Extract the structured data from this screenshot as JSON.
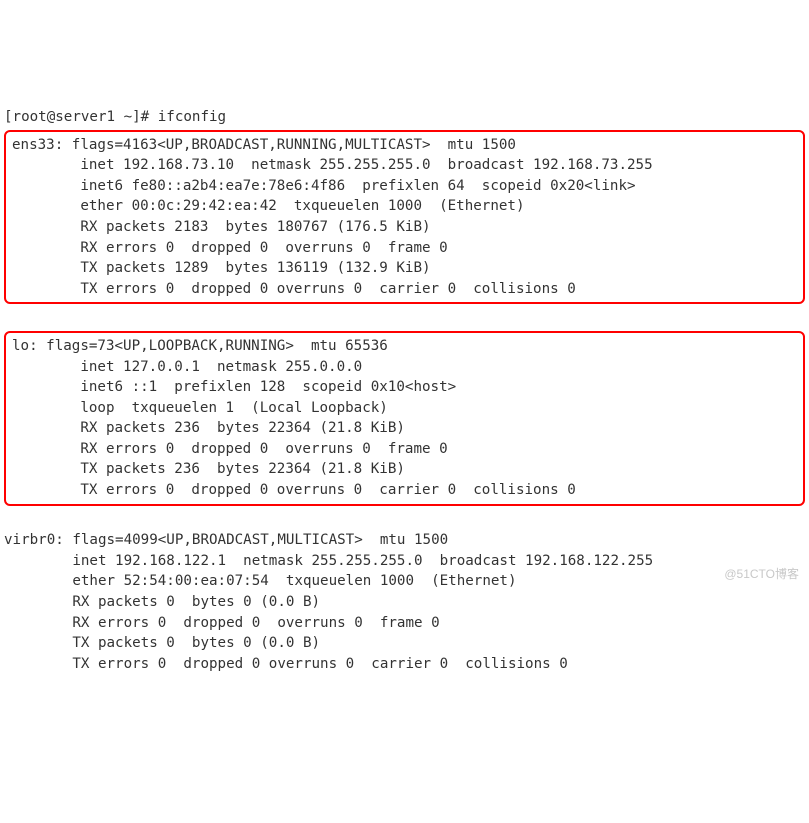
{
  "prompt": "[root@server1 ~]# ifconfig",
  "ens33": {
    "l1": "ens33: flags=4163<UP,BROADCAST,RUNNING,MULTICAST>  mtu 1500",
    "l2": "        inet 192.168.73.10  netmask 255.255.255.0  broadcast 192.168.73.255",
    "l3": "        inet6 fe80::a2b4:ea7e:78e6:4f86  prefixlen 64  scopeid 0x20<link>",
    "l4": "        ether 00:0c:29:42:ea:42  txqueuelen 1000  (Ethernet)",
    "l5": "        RX packets 2183  bytes 180767 (176.5 KiB)",
    "l6": "        RX errors 0  dropped 0  overruns 0  frame 0",
    "l7": "        TX packets 1289  bytes 136119 (132.9 KiB)",
    "l8": "        TX errors 0  dropped 0 overruns 0  carrier 0  collisions 0"
  },
  "lo": {
    "l1": "lo: flags=73<UP,LOOPBACK,RUNNING>  mtu 65536",
    "l2": "        inet 127.0.0.1  netmask 255.0.0.0",
    "l3": "        inet6 ::1  prefixlen 128  scopeid 0x10<host>",
    "l4": "        loop  txqueuelen 1  (Local Loopback)",
    "l5": "        RX packets 236  bytes 22364 (21.8 KiB)",
    "l6": "        RX errors 0  dropped 0  overruns 0  frame 0",
    "l7": "        TX packets 236  bytes 22364 (21.8 KiB)",
    "l8": "        TX errors 0  dropped 0 overruns 0  carrier 0  collisions 0"
  },
  "virbr0": {
    "l1": "virbr0: flags=4099<UP,BROADCAST,MULTICAST>  mtu 1500",
    "l2": "        inet 192.168.122.1  netmask 255.255.255.0  broadcast 192.168.122.255",
    "l3": "        ether 52:54:00:ea:07:54  txqueuelen 1000  (Ethernet)",
    "l4": "        RX packets 0  bytes 0 (0.0 B)",
    "l5": "        RX errors 0  dropped 0  overruns 0  frame 0",
    "l6": "        TX packets 0  bytes 0 (0.0 B)",
    "l7": "        TX errors 0  dropped 0 overruns 0  carrier 0  collisions 0"
  },
  "watermark": "@51CTO博客"
}
